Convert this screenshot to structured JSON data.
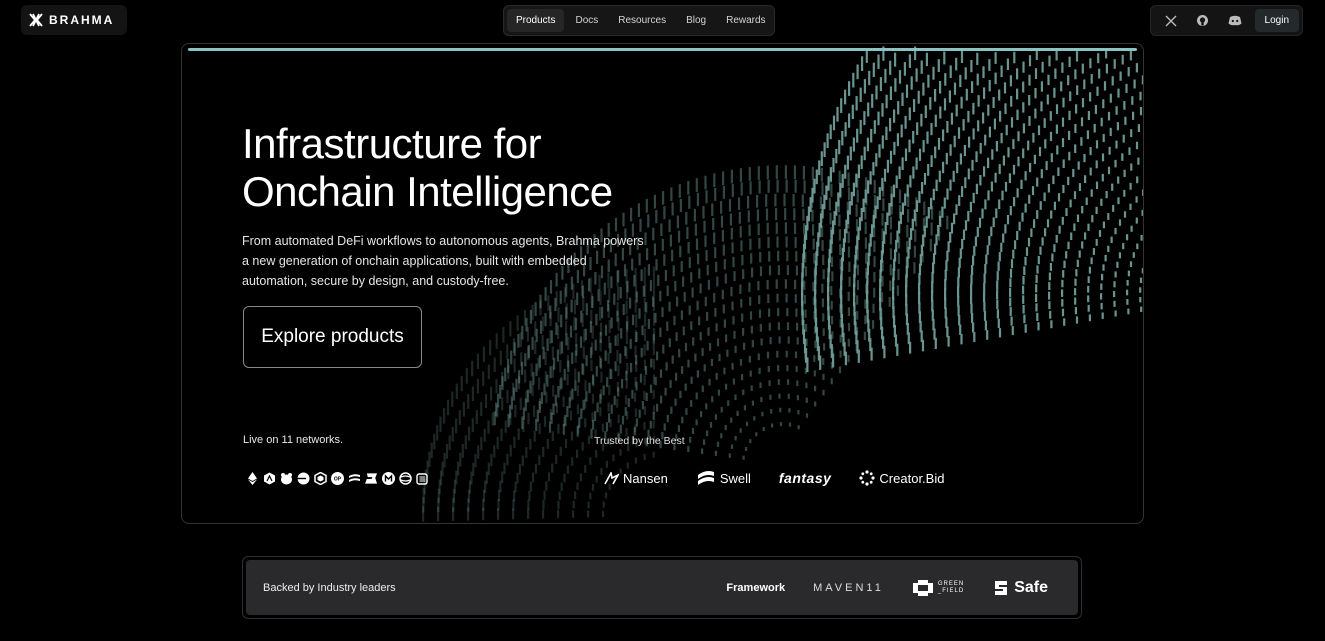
{
  "brand": {
    "name": "BRAHMA",
    "icon": "brahma-logo-icon"
  },
  "nav": {
    "items": [
      {
        "label": "Products",
        "active": true
      },
      {
        "label": "Docs",
        "active": false
      },
      {
        "label": "Resources",
        "active": false
      },
      {
        "label": "Blog",
        "active": false
      },
      {
        "label": "Rewards",
        "active": false
      }
    ]
  },
  "topright": {
    "icons": [
      "x-icon",
      "github-icon",
      "discord-icon"
    ],
    "login_label": "Login"
  },
  "hero": {
    "title_line1": "Infrastructure for",
    "title_line2": "Onchain Intelligence",
    "subtitle": "From automated DeFi workflows to autonomous agents, Brahma powers a new generation of onchain applications, built with embedded automation, secure by design, and custody-free.",
    "cta_label": "Explore products",
    "live_label": "Live on 11 networks.",
    "networks": [
      "ethereum-icon",
      "arbitrum-icon",
      "bera-icon",
      "base-icon",
      "polygon-icon",
      "optimism-icon",
      "swell-chain-icon",
      "blast-icon",
      "mantle-icon",
      "sonic-icon",
      "scroll-icon"
    ],
    "trusted_label": "Trusted by the Best",
    "partners": [
      "Nansen",
      "Swell",
      "fantasy",
      "Creator.Bid"
    ],
    "accent_color": "#8bc2c2",
    "pattern_color": "#6f9c97"
  },
  "backers": {
    "label": "Backed by Industry leaders",
    "framework": "Framework",
    "maven": "MAVEN11",
    "greenfield_line1": "GREEN",
    "greenfield_line2": "_FIELD",
    "safe": "Safe"
  }
}
